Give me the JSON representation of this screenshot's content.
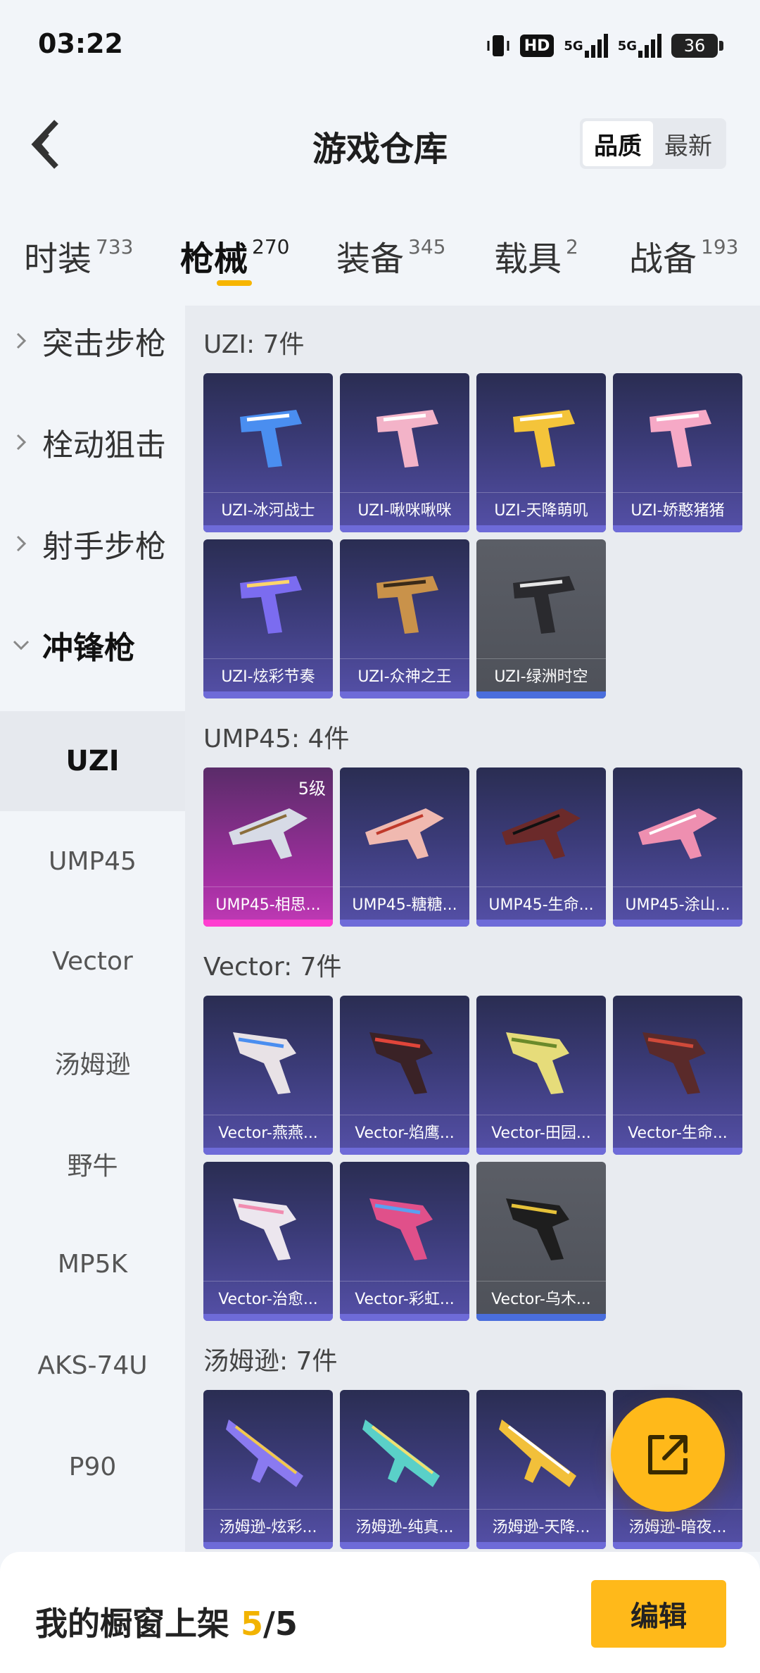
{
  "status": {
    "time": "03:22",
    "hd_label": "HD",
    "net1": "5G",
    "net2": "5G",
    "battery": "36"
  },
  "header": {
    "title": "游戏仓库",
    "sort_options": [
      "品质",
      "最新"
    ]
  },
  "tabs": [
    {
      "label": "时装",
      "count": "733"
    },
    {
      "label": "枪械",
      "count": "270"
    },
    {
      "label": "装备",
      "count": "345"
    },
    {
      "label": "载具",
      "count": "2"
    },
    {
      "label": "战备",
      "count": "193"
    }
  ],
  "sidebar": {
    "groups": [
      "突击步枪",
      "栓动狙击",
      "射手步枪",
      "冲锋枪"
    ],
    "items": [
      "UZI",
      "UMP45",
      "Vector",
      "汤姆逊",
      "野牛",
      "MP5K",
      "AKS-74U",
      "P90"
    ]
  },
  "sections": {
    "uzi": {
      "title": "UZI: 7件",
      "cards": [
        "UZI-冰河战士",
        "UZI-啾咪啾咪",
        "UZI-天降萌叽",
        "UZI-娇憨猪猪",
        "UZI-炫彩节奏",
        "UZI-众神之王",
        "UZI-绿洲时空"
      ]
    },
    "ump45": {
      "title": "UMP45: 4件",
      "level_badge": "5级",
      "cards": [
        "UMP45-相思...",
        "UMP45-糖糖...",
        "UMP45-生命...",
        "UMP45-涂山..."
      ]
    },
    "vector": {
      "title": "Vector: 7件",
      "cards": [
        "Vector-燕燕...",
        "Vector-焰鹰...",
        "Vector-田园...",
        "Vector-生命...",
        "Vector-治愈...",
        "Vector-彩虹...",
        "Vector-乌木..."
      ]
    },
    "thompson": {
      "title": "汤姆逊: 7件",
      "cards": [
        "汤姆逊-炫彩...",
        "汤姆逊-纯真...",
        "汤姆逊-天降...",
        "汤姆逊-暗夜..."
      ]
    }
  },
  "bottom": {
    "label": "我的橱窗上架",
    "current": "5",
    "total": "/5",
    "edit": "编辑"
  },
  "colors": {
    "accent": "#ffb91a",
    "card_blue": "#5550a8",
    "card_pink": "#c13ab6",
    "card_gray": "#5b5e66"
  }
}
